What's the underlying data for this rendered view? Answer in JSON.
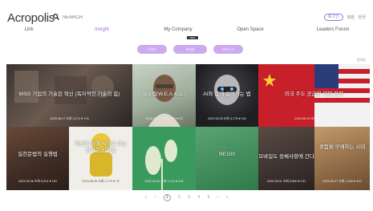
{
  "header": {
    "logo": "Acropolis",
    "search_placeholder": "SEARCH",
    "top_links": [
      "로그인",
      "회원",
      "한국"
    ]
  },
  "nav": {
    "items": [
      "Link",
      "Insight",
      "My Company",
      "Open Space",
      "Leaders Forum"
    ],
    "active": "Insight",
    "new_badge": "NEW"
  },
  "filters": [
    "트렌드",
    "리더십",
    "비즈니스"
  ],
  "sort_label": "인기순",
  "cards": [
    {
      "title": "MSG 기업의 기술된 혁신 (독자적인 기술의 힘)",
      "meta": "2023.06.27 조회 3,274 ♥ 176"
    },
    {
      "title": "워라밸(W.E.A.K.D.)",
      "meta": "2023.06.26 조회 2,776 ♥ 53"
    },
    {
      "title": "AI와 함께 살아가는 법",
      "meta": "2023.06.25 조회 4,175 ♥ 161"
    },
    {
      "title": "미국 주도 공급망 재편 전략",
      "meta": "2023.06.19 조회 4,175 ♥ 161"
    },
    {
      "title": "실천문법의 실행법",
      "meta": "2023.06.06 조회 5,201 ♥ 151"
    },
    {
      "title": "혁신의 향해 사례로 보는 반기문 리더십",
      "meta": "2023.06.06 조회 2,770 ♥ 74"
    },
    {
      "title": "RE100",
      "meta": "2023.06.06 조회 3,124 ♥ 102"
    },
    {
      "title": "모바일도 정체사항에 간다",
      "meta": "2023.06.01 조회 5,650 ♥ 131"
    },
    {
      "title": "경험을 구매하는 시대",
      "meta": "2023.05.27 조회 2,930 ♥ 122"
    }
  ],
  "pagination": {
    "prev_prev": "«",
    "prev": "‹",
    "pages": [
      "1",
      "2",
      "3",
      "4",
      "5"
    ],
    "current": "1",
    "next": "›",
    "next_next": "»"
  },
  "colors": {
    "accent": "#9b6fd6",
    "pill": "#cda9f0"
  }
}
